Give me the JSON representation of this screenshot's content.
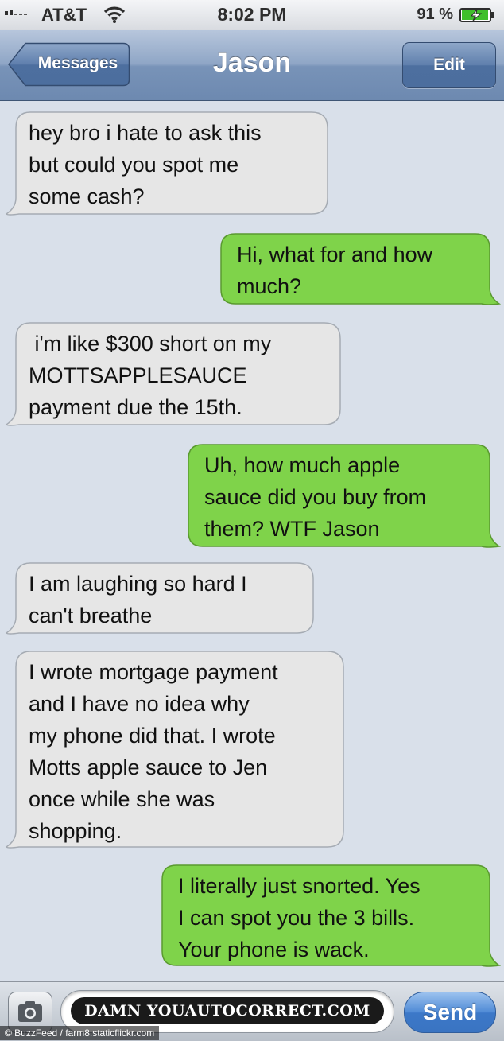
{
  "status_bar": {
    "carrier": "AT&T",
    "time": "8:02 PM",
    "battery_percent": "91 %",
    "signal_icon": "signal-bars-icon",
    "wifi_icon": "wifi-icon",
    "battery_icon": "battery-charging-icon"
  },
  "nav": {
    "back_label": "Messages",
    "title": "Jason",
    "edit_label": "Edit"
  },
  "messages": [
    {
      "from": "them",
      "text": "hey bro i hate to ask this\nbut could you spot me\nsome cash?"
    },
    {
      "from": "me",
      "text": "Hi, what for and how\nmuch?"
    },
    {
      "from": "them",
      "text": " i'm like $300 short on my\nMOTTSAPPLESAUCE\npayment due the 15th."
    },
    {
      "from": "me",
      "text": "Uh, how much apple\nsauce did you buy from\nthem? WTF Jason"
    },
    {
      "from": "them",
      "text": "I am laughing so hard I\ncan't breathe"
    },
    {
      "from": "them",
      "text": "I wrote mortgage payment\nand I have no idea why\nmy phone did that. I wrote\nMotts apple sauce to Jen\nonce while she was\nshopping."
    },
    {
      "from": "me",
      "text": "I literally just snorted. Yes\nI can spot you the 3 bills.\nYour phone is wack."
    }
  ],
  "input_bar": {
    "camera_icon": "camera-icon",
    "watermark": "DAMN YOUAUTOCORRECT.COM",
    "send_label": "Send"
  },
  "credit": "© BuzzFeed / farm8.staticflickr.com",
  "colors": {
    "background": "#d9e0ea",
    "received_bubble": "#e6e6e6",
    "sent_bubble": "#7fd34a",
    "nav_bar": "#7893b8"
  }
}
